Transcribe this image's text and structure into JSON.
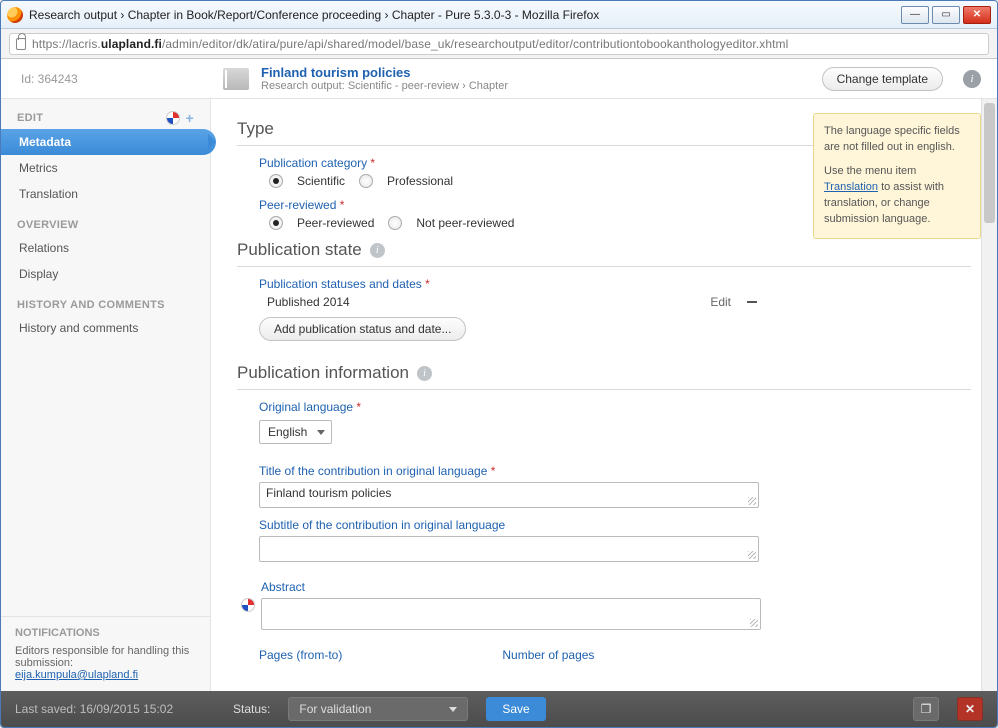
{
  "window": {
    "title": "Research output › Chapter in Book/Report/Conference proceeding › Chapter - Pure 5.3.0-3 - Mozilla Firefox"
  },
  "url": {
    "pre": "https://lacris.",
    "host": "ulapland.fi",
    "post": "/admin/editor/dk/atira/pure/api/shared/model/base_uk/researchoutput/editor/contributiontobookanthologyeditor.xhtml"
  },
  "header": {
    "id": "Id: 364243",
    "title": "Finland tourism policies",
    "subtitle": "Research output: Scientific - peer-review › Chapter",
    "change": "Change template"
  },
  "sidebar": {
    "groups": {
      "edit": "EDIT",
      "overview": "OVERVIEW",
      "history": "HISTORY AND COMMENTS",
      "notifications": "NOTIFICATIONS"
    },
    "items": {
      "metadata": "Metadata",
      "metrics": "Metrics",
      "translation": "Translation",
      "relations": "Relations",
      "display": "Display",
      "histcom": "History and comments"
    },
    "notif_text": "Editors responsible for handling this submission:",
    "notif_email": "eija.kumpula@ulapland.fi"
  },
  "sections": {
    "type": "Type",
    "pubstate": "Publication state",
    "pubinfo": "Publication information"
  },
  "fields": {
    "pubcat": "Publication category",
    "pubcat_opts": {
      "sci": "Scientific",
      "pro": "Professional"
    },
    "peer": "Peer-reviewed",
    "peer_opts": {
      "yes": "Peer-reviewed",
      "no": "Not peer-reviewed"
    },
    "pubstatuses": "Publication statuses and dates",
    "pubstatus_val": "Published 2014",
    "edit": "Edit",
    "addstatus": "Add publication status and date...",
    "origlang": "Original language",
    "origlang_val": "English",
    "title_contrib": "Title of the contribution in original language",
    "title_val": "Finland tourism policies",
    "subtitle_contrib": "Subtitle of the contribution in original language",
    "abstract": "Abstract",
    "pages": "Pages (from-to)",
    "numpages": "Number of pages"
  },
  "hint": {
    "l1": "The language specific fields are not filled out in english.",
    "l2a": "Use the menu item ",
    "l2link": "Translation",
    "l2b": " to assist with translation, or change submission language."
  },
  "footer": {
    "saved": "Last saved: 16/09/2015 15:02",
    "status_lbl": "Status:",
    "status_val": "For validation",
    "save": "Save"
  }
}
